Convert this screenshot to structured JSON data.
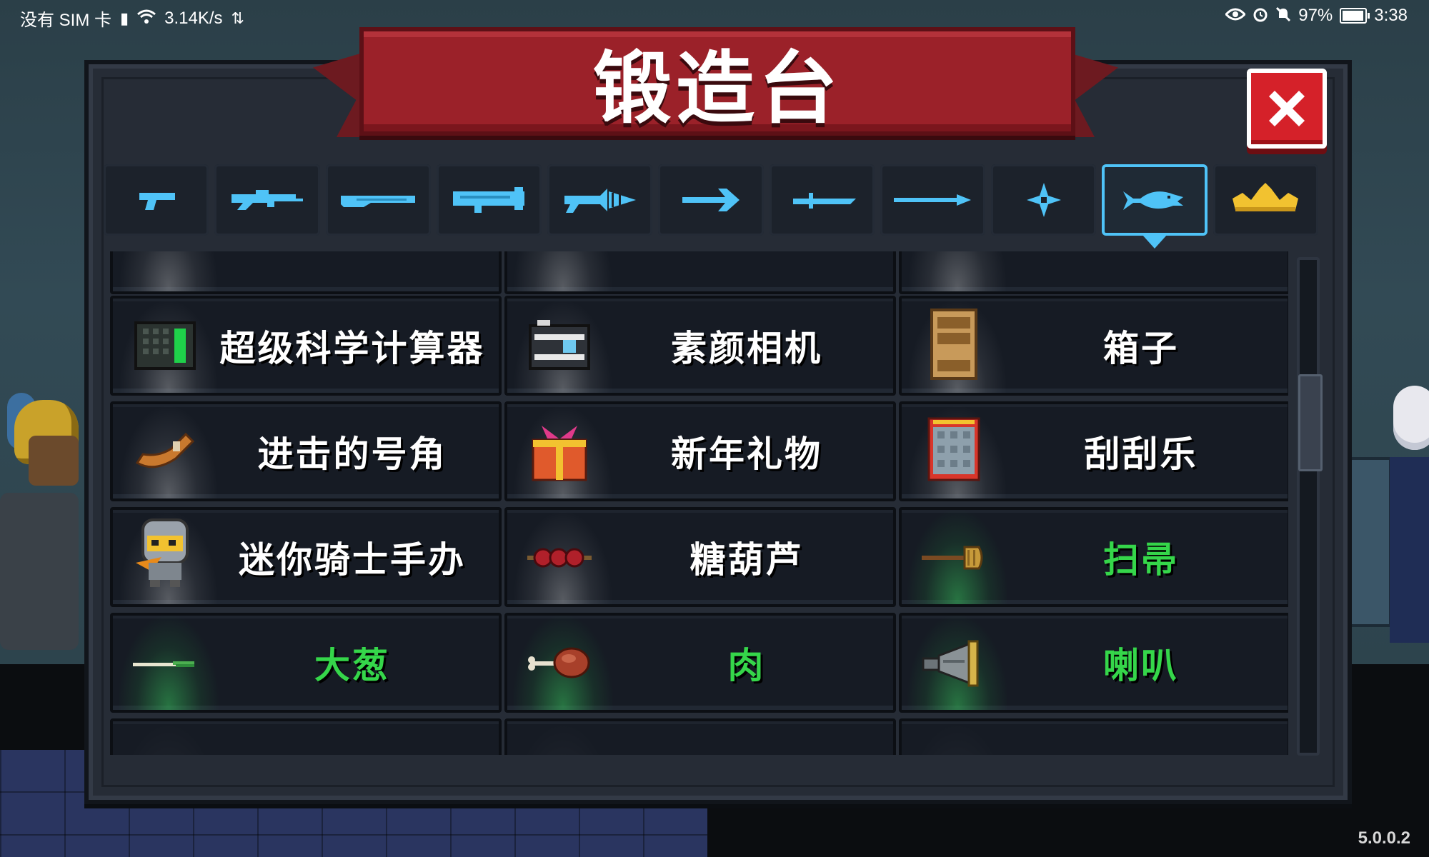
{
  "status_bar": {
    "carrier": "没有 SIM 卡",
    "speed": "3.14K/s",
    "battery": "97%",
    "battery_level": 0.97,
    "time": "3:38",
    "icons": [
      "sim-alert-icon",
      "wifi-icon",
      "data-icon",
      "eye-icon",
      "alarm-icon",
      "mute-icon",
      "battery-icon"
    ]
  },
  "dialog": {
    "title": "锻造台",
    "close_icon": "close-icon"
  },
  "tabs": [
    {
      "icon": "pistol-icon",
      "selected": false
    },
    {
      "icon": "rifle-icon",
      "selected": false
    },
    {
      "icon": "shotgun-icon",
      "selected": false
    },
    {
      "icon": "launcher-icon",
      "selected": false
    },
    {
      "icon": "laser-gun-icon",
      "selected": false
    },
    {
      "icon": "bow-icon",
      "selected": false
    },
    {
      "icon": "sword-icon",
      "selected": false
    },
    {
      "icon": "spear-icon",
      "selected": false
    },
    {
      "icon": "shuriken-icon",
      "selected": false
    },
    {
      "icon": "fish-icon",
      "selected": true
    },
    {
      "icon": "crown-icon",
      "selected": false
    }
  ],
  "items": [
    {
      "label": "超级科学计算器",
      "icon": "calculator-icon",
      "color": "white"
    },
    {
      "label": "素颜相机",
      "icon": "camera-icon",
      "color": "white"
    },
    {
      "label": "箱子",
      "icon": "cabinet-icon",
      "color": "white"
    },
    {
      "label": "进击的号角",
      "icon": "horn-icon",
      "color": "white"
    },
    {
      "label": "新年礼物",
      "icon": "gift-icon",
      "color": "white"
    },
    {
      "label": "刮刮乐",
      "icon": "scratch-card-icon",
      "color": "white"
    },
    {
      "label": "迷你骑士手办",
      "icon": "knight-figure-icon",
      "color": "white"
    },
    {
      "label": "糖葫芦",
      "icon": "candied-haws-icon",
      "color": "white"
    },
    {
      "label": "扫帚",
      "icon": "broom-icon",
      "color": "green"
    },
    {
      "label": "大葱",
      "icon": "leek-icon",
      "color": "green"
    },
    {
      "label": "肉",
      "icon": "meat-icon",
      "color": "green"
    },
    {
      "label": "喇叭",
      "icon": "megaphone-icon",
      "color": "green"
    }
  ],
  "colors": {
    "accent_blue": "#4fc3f7",
    "ribbon_red": "#9b2129",
    "close_red": "#d52129",
    "rarity_green": "#35d64a"
  },
  "version": "5.0.0.2"
}
